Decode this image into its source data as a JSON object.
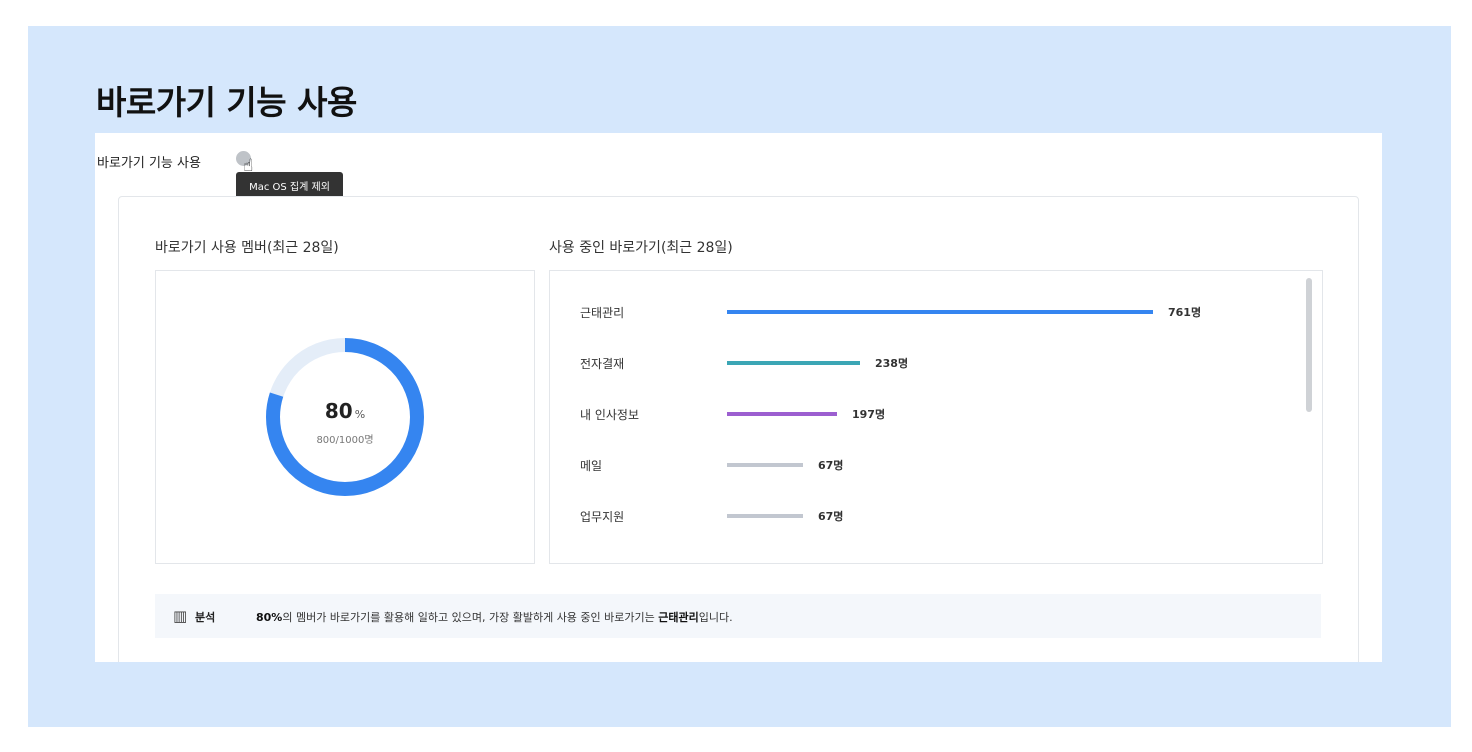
{
  "page": {
    "title": "바로가기 기능 사용"
  },
  "card": {
    "title": "바로가기 기능 사용",
    "tooltip": "Mac OS 집계 제외"
  },
  "members": {
    "title": "바로가기 사용 멤버(최근 28일)",
    "percent": "80",
    "percent_unit": "%",
    "ratio": "800/1000명",
    "fraction": 0.8,
    "colors": {
      "fill": "#3585f0",
      "track": "#e4edf8"
    }
  },
  "shortcuts": {
    "title": "사용 중인 바로가기(최근 28일)",
    "max": 761,
    "items": [
      {
        "label": "근태관리",
        "value": 761,
        "value_text": "761명",
        "color": "#3585f0"
      },
      {
        "label": "전자결재",
        "value": 238,
        "value_text": "238명",
        "color": "#3ba6b5"
      },
      {
        "label": "내 인사정보",
        "value": 197,
        "value_text": "197명",
        "color": "#9c5fd0"
      },
      {
        "label": "메일",
        "value": 67,
        "value_text": "67명",
        "color": "#c2c7d0"
      },
      {
        "label": "업무지원",
        "value": 67,
        "value_text": "67명",
        "color": "#c2c7d0"
      }
    ]
  },
  "analysis": {
    "icon": "bar-chart-icon",
    "label": "분석",
    "percent_bold": "80%",
    "text_1": "의 멤버가 바로가기를 활용해 일하고 있으며, 가장 활발하게 사용 중인 바로가기는 ",
    "top_bold": "근태관리",
    "text_2": "입니다."
  }
}
